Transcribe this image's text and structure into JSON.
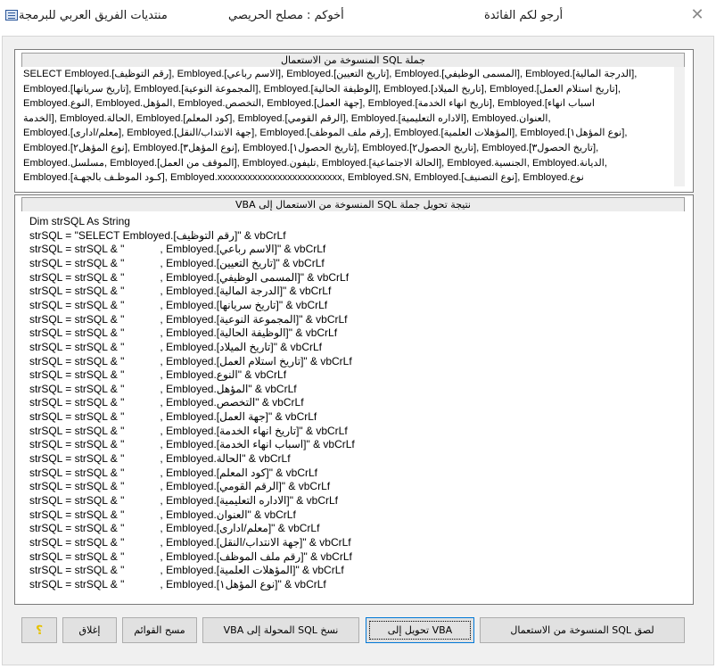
{
  "window": {
    "title_forum": "منتديات الفريق العربي للبرمجة",
    "title_author": "أخوكم : مصلح الحريصي",
    "title_wish": "أرجو لكم الفائدة",
    "close_glyph": "✕"
  },
  "sql_section": {
    "caption": "جملة SQL المنسوخة من الاستعمال",
    "lines": [
      "SELECT Embloyed.[رقم التوظيف], Embloyed.[الاسم رباعي], Embloyed.[تاريخ التعيين], Embloyed.[المسمى الوظيفي], Embloyed.[الدرجة المالية],",
      "Embloyed.[تاريخ سريانها], Embloyed.[المجموعة النوعية], Embloyed.[الوظيفة الحالية], Embloyed.[تاريخ الميلاد], Embloyed.[تاريخ استلام العمل],",
      "Embloyed.النوع, Embloyed.المؤهل, Embloyed.التخصص, Embloyed.[جهة العمل], Embloyed.[تاريخ انهاء الخدمة], Embloyed.[اسباب انهاء",
      "الخدمة], Embloyed.الحالة, Embloyed.[كود المعلم], Embloyed.[الرقم القومي], Embloyed.[الاداره التعليمية], Embloyed.العنوان,",
      "Embloyed.[معلم/ادارى], Embloyed.[جهة الانتداب/النقل], Embloyed.[رقم ملف الموظف], Embloyed.[المؤهلات العلمية], Embloyed.[نوع المؤهل١],",
      "Embloyed.[نوع المؤهل٢], Embloyed.[نوع المؤهل٣], Embloyed.[تاريخ الحصول١], Embloyed.[تاريخ الحصول٢], Embloyed.[تاريخ الحصول٣],",
      "Embloyed.مسلسل, Embloyed.[الموقف من العمل], Embloyed.تليفون, Embloyed.[الحالة الاجتماعية], Embloyed.الجنسية, Embloyed.الديانة,",
      "Embloyed.[كـود الموظـف بالجهـة], Embloyed.xxxxxxxxxxxxxxxxxxxxxxxxx, Embloyed.SN, Embloyed.[نوع التصنيف], Embloyed.نوع"
    ]
  },
  "vba_section": {
    "caption": "نتيجة تحويل جملة SQL المنسوخة من الاستعمال  إلى VBA",
    "lines": [
      "Dim strSQL As String",
      "strSQL = \"SELECT Embloyed.[رقم التوظيف]\" & vbCrLf",
      "strSQL = strSQL & \"            , Embloyed.[الاسم رباعي]\" & vbCrLf",
      "strSQL = strSQL & \"            , Embloyed.[تاريخ التعيين]\" & vbCrLf",
      "strSQL = strSQL & \"            , Embloyed.[المسمى الوظيفي]\" & vbCrLf",
      "strSQL = strSQL & \"            , Embloyed.[الدرجة المالية]\" & vbCrLf",
      "strSQL = strSQL & \"            , Embloyed.[تاريخ سريانها]\" & vbCrLf",
      "strSQL = strSQL & \"            , Embloyed.[المجموعة النوعية]\" & vbCrLf",
      "strSQL = strSQL & \"            , Embloyed.[الوظيفة الحالية]\" & vbCrLf",
      "strSQL = strSQL & \"            , Embloyed.[تاريخ الميلاد]\" & vbCrLf",
      "strSQL = strSQL & \"            , Embloyed.[تاريخ استلام العمل]\" & vbCrLf",
      "strSQL = strSQL & \"            , Embloyed.النوع\" & vbCrLf",
      "strSQL = strSQL & \"            , Embloyed.المؤهل\" & vbCrLf",
      "strSQL = strSQL & \"            , Embloyed.التخصص\" & vbCrLf",
      "strSQL = strSQL & \"            , Embloyed.[جهة العمل]\" & vbCrLf",
      "strSQL = strSQL & \"            , Embloyed.[تاريخ انهاء الخدمة]\" & vbCrLf",
      "strSQL = strSQL & \"            , Embloyed.[اسباب انهاء الخدمة]\" & vbCrLf",
      "strSQL = strSQL & \"            , Embloyed.الحالة\" & vbCrLf",
      "strSQL = strSQL & \"            , Embloyed.[كود المعلم]\" & vbCrLf",
      "strSQL = strSQL & \"            , Embloyed.[الرقم القومي]\" & vbCrLf",
      "strSQL = strSQL & \"            , Embloyed.[الاداره التعليمية]\" & vbCrLf",
      "strSQL = strSQL & \"            , Embloyed.العنوان\" & vbCrLf",
      "strSQL = strSQL & \"            , Embloyed.[معلم/ادارى]\" & vbCrLf",
      "strSQL = strSQL & \"            , Embloyed.[جهة الانتداب/النقل]\" & vbCrLf",
      "strSQL = strSQL & \"            , Embloyed.[رقم ملف الموظف]\" & vbCrLf",
      "strSQL = strSQL & \"            , Embloyed.[المؤهلات العلمية]\" & vbCrLf",
      "strSQL = strSQL & \"            , Embloyed.[نوع المؤهل١]\" & vbCrLf"
    ]
  },
  "buttons": {
    "paste_sql": "لصق SQL المنسوخة من الاستعمال",
    "convert_vba": "تحويل إلى VBA",
    "copy_sql": "نسخ SQL المحولة إلى VBA",
    "clear_lists": "مسح القوائم",
    "close": "إغلاق",
    "help": "؟"
  }
}
